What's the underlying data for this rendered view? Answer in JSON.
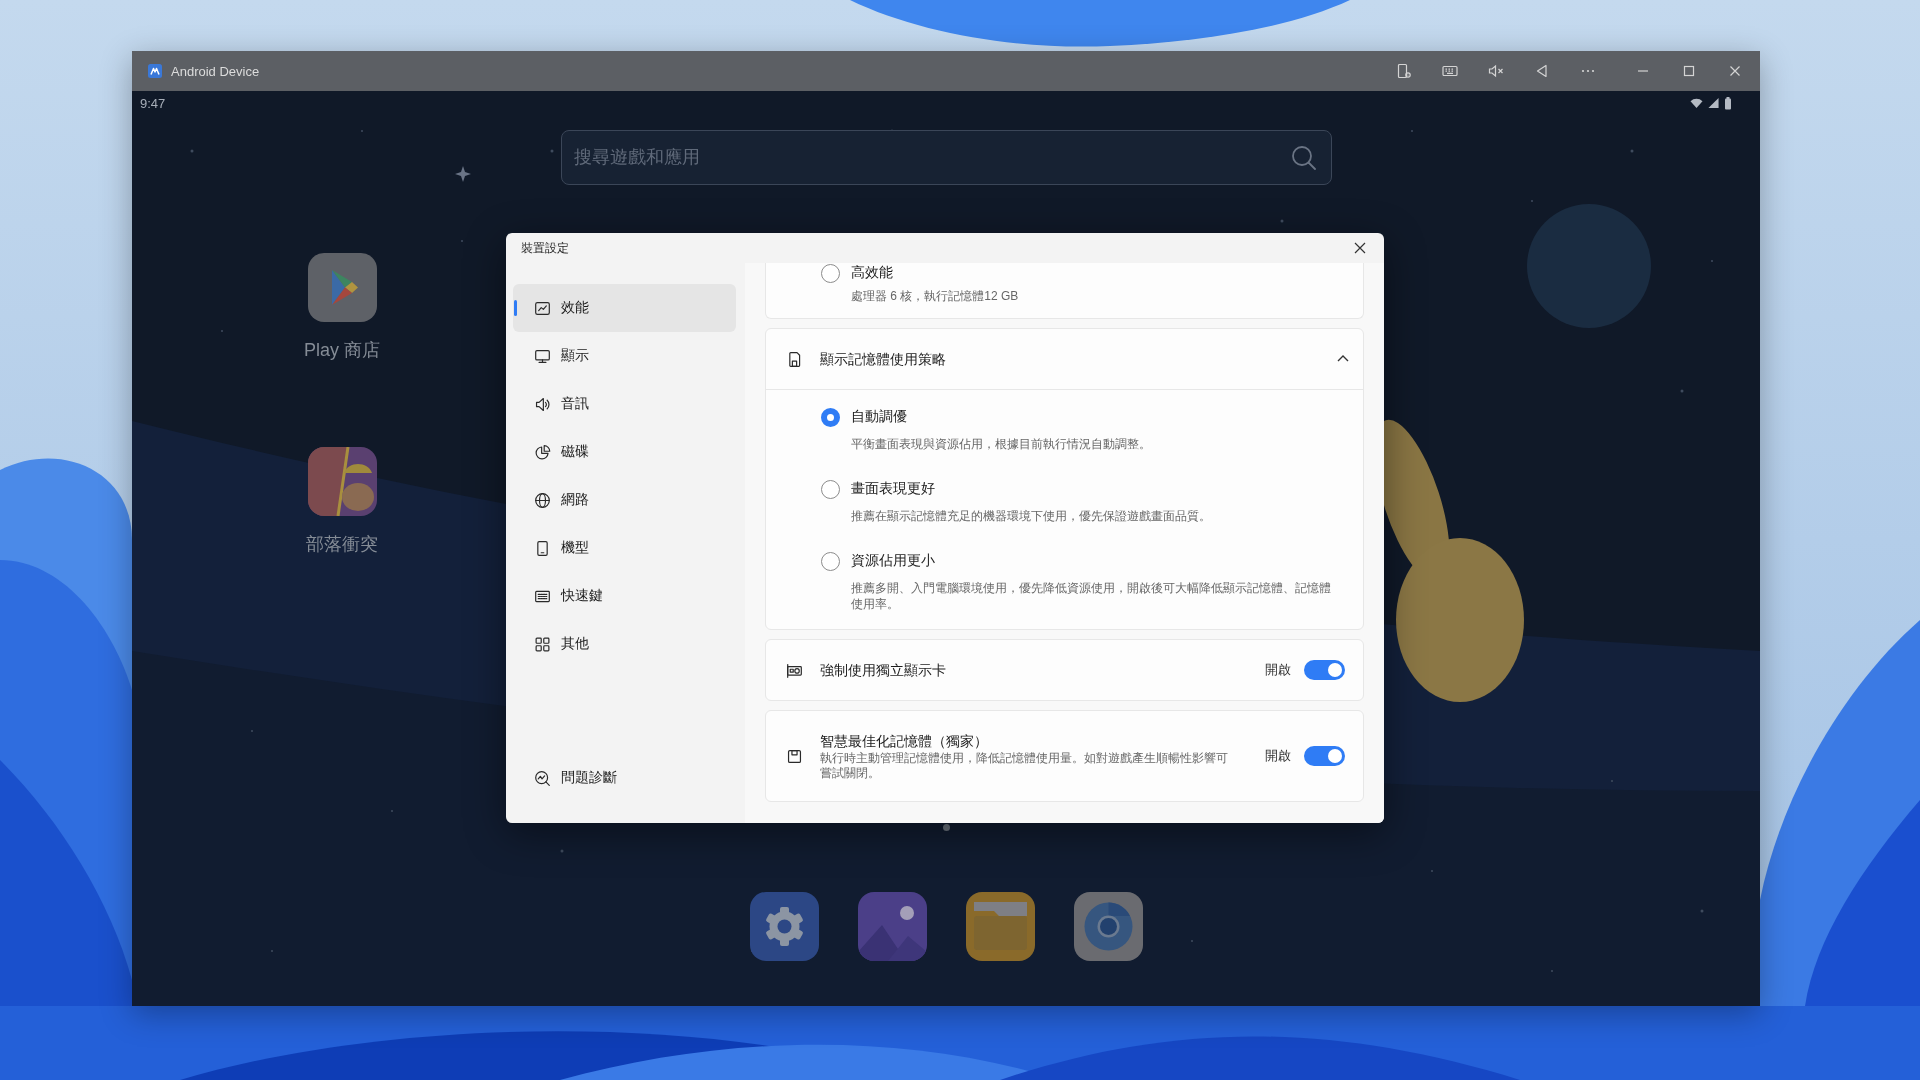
{
  "window": {
    "title": "Android Device"
  },
  "status_bar": {
    "time": "9:47"
  },
  "search": {
    "placeholder": "搜尋遊戲和應用"
  },
  "home_apps": [
    {
      "label": "Play 商店"
    },
    {
      "label": "部落衝突"
    }
  ],
  "dialog": {
    "title": "裝置設定",
    "sidebar": {
      "items": [
        {
          "label": "效能",
          "selected": true
        },
        {
          "label": "顯示",
          "selected": false
        },
        {
          "label": "音訊",
          "selected": false
        },
        {
          "label": "磁碟",
          "selected": false
        },
        {
          "label": "網路",
          "selected": false
        },
        {
          "label": "機型",
          "selected": false
        },
        {
          "label": "快速鍵",
          "selected": false
        },
        {
          "label": "其他",
          "selected": false
        }
      ],
      "footer_item": {
        "label": "問題診斷"
      }
    },
    "sections": [
      {
        "kind": "radio_group",
        "options": [
          {
            "label": "高效能",
            "description": "處理器 6 核，執行記憶體12 GB",
            "selected": false
          }
        ]
      },
      {
        "kind": "radio_group",
        "title": "顯示記憶體使用策略",
        "expanded": true,
        "options": [
          {
            "label": "自動調優",
            "description": "平衡畫面表現與資源佔用，根據目前執行情況自動調整。",
            "selected": true
          },
          {
            "label": "畫面表現更好",
            "description": "推薦在顯示記憶體充足的機器環境下使用，優先保證遊戲畫面品質。",
            "selected": false
          },
          {
            "label": "資源佔用更小",
            "description": "推薦多開、入門電腦環境使用，優先降低資源使用，開啟後可大幅降低顯示記憶體、記憶體使用率。",
            "selected": false
          }
        ]
      },
      {
        "kind": "toggle",
        "title": "強制使用獨立顯示卡",
        "state_label": "開啟",
        "on": true
      },
      {
        "kind": "toggle",
        "title": "智慧最佳化記憶體（獨家）",
        "description": "執行時主動管理記憶體使用，降低記憶體使用量。如對遊戲產生順暢性影響可嘗試關閉。",
        "state_label": "開啟",
        "on": true
      }
    ]
  }
}
